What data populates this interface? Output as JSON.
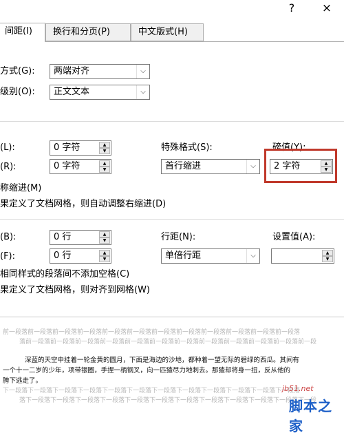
{
  "titlebar": {
    "help": "?",
    "close": "×"
  },
  "tabs": [
    {
      "label": "间距(I)"
    },
    {
      "label": "换行和分页(P)"
    },
    {
      "label": "中文版式(H)"
    }
  ],
  "general": {
    "alignment_label": "方式(G):",
    "alignment_value": "两端对齐",
    "outline_label": "级别(O):",
    "outline_value": "正文文本"
  },
  "indent": {
    "left_label": "(L):",
    "left_value": "0 字符",
    "right_label": "(R):",
    "right_value": "0 字符",
    "special_label": "特殊格式(S):",
    "special_value": "首行缩进",
    "by_label": "磅值(Y):",
    "by_value": "2 字符",
    "mirror_label": "称缩进(M)",
    "auto_adjust_label": "果定义了文档网格，则自动调整右缩进(D)"
  },
  "spacing": {
    "before_label": "(B):",
    "before_value": "0 行",
    "after_label": "(F):",
    "after_value": "0 行",
    "line_label": "行距(N):",
    "line_value": "单倍行距",
    "at_label": "设置值(A):",
    "at_value": "",
    "no_space_label": "相同样式的段落间不添加空格(C)",
    "snap_grid_label": "果定义了文档网格，则对齐到网格(W)"
  },
  "preview": {
    "prev_line1": "前一段落前一段落前一段落前一段落前一段落前一段落前一段落前一段落前一段落前一段落前一段落前一段落",
    "prev_line2": "落前一段落前一段落前一段落前一段落前一段落前一段落前一段落前一段落前一段落前一段落前一段落前一段",
    "sample_line1": "深蓝的天空中挂着一轮金黄的圆月，下面是海边的沙地，都种着一望无际的碧绿的西瓜。其间有",
    "sample_line2": "一个十一二岁的少年，项带银圈，手捏一柄钢叉，向一匹猹尽力地刺去。那猹却将身一扭，反从他的",
    "sample_line3": "胯下逃走了。",
    "next_line1": "下一段落下一段落下一段落下一段落下一段落下一段落下一段落下一段落下一段落下一段落下一段落下一段落",
    "next_line2": "落下一段落下一段落下一段落下一段落下一段落下一段落下一段落下一段落下一段落下一段落下一段落下一段"
  },
  "watermark": {
    "site": "jb51.net",
    "brand": "脚本之家"
  }
}
